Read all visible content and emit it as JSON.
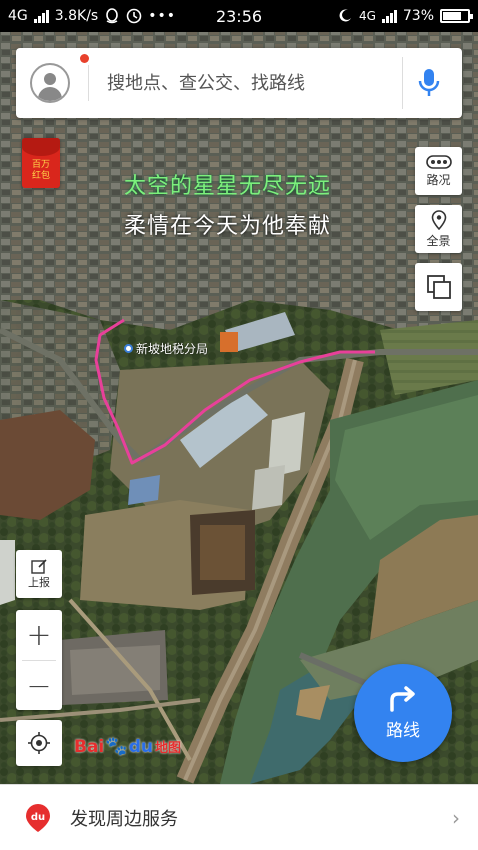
{
  "status_bar": {
    "network_left": "4G",
    "speed": "3.8K/s",
    "time": "23:56",
    "network_right": "4G",
    "battery": "73%",
    "battery_level": 0.73
  },
  "search": {
    "placeholder": "搜地点、查公交、找路线"
  },
  "red_envelope": {
    "text": "百万红包"
  },
  "overlay": {
    "line1": "太空的星星无尽无远",
    "line2": "柔情在今天为他奉献"
  },
  "map": {
    "poi_label": "新坡地税分局",
    "route_color": "#e8409a",
    "logo": {
      "bai": "Bai",
      "du": "du",
      "suffix": "地图"
    }
  },
  "right_tools": {
    "traffic_label": "路况",
    "panorama_label": "全景"
  },
  "left_tools": {
    "report_label": "上报",
    "zoom_in": "+",
    "zoom_out": "−"
  },
  "route_button": {
    "label": "路线"
  },
  "bottom_bar": {
    "text": "发现周边服务",
    "chevron": "›"
  },
  "colors": {
    "accent": "#3383f0",
    "brand_red": "#e62e2e",
    "notification_dot": "#e8412c"
  }
}
